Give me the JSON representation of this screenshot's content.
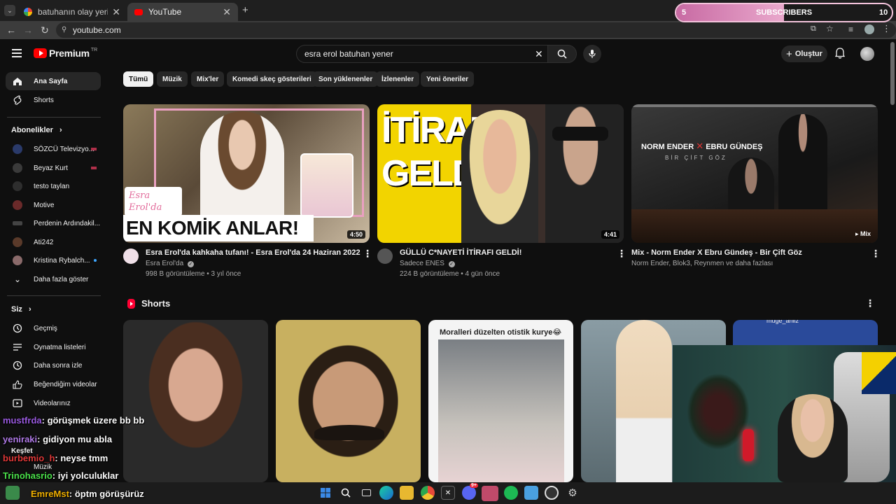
{
  "browser": {
    "tabs": [
      {
        "title": "batuhanın olay yeri - Google'da",
        "active": false
      },
      {
        "title": "YouTube",
        "active": true
      }
    ],
    "url": "youtube.com"
  },
  "youtube": {
    "logo": "Premium",
    "logo_region": "TR",
    "search_value": "esra erol batuhan yener",
    "create_label": "Oluştur",
    "sidebar": {
      "home": "Ana Sayfa",
      "shorts": "Shorts",
      "subscriptions_heading": "Abonelikler",
      "subscriptions": [
        {
          "name": "SÖZCÜ Televizyo...",
          "badge": "live-bar",
          "avatar_color": "#2a3a6a"
        },
        {
          "name": "Beyaz Kurt",
          "badge": "live-bar",
          "avatar_color": "#3a3a3a"
        },
        {
          "name": "testo taylan",
          "badge": "",
          "avatar_color": "#2e2e2e"
        },
        {
          "name": "Motive",
          "badge": "",
          "avatar_color": "#6a2a2a"
        },
        {
          "name": "Perdenin Ardındakil...",
          "badge": "",
          "avatar_color": "#444444"
        },
        {
          "name": "Ati242",
          "badge": "",
          "avatar_color": "#5a3a2a"
        },
        {
          "name": "Kristina Rybalch...",
          "badge": "dot",
          "avatar_color": "#8a6a6a"
        }
      ],
      "show_more": "Daha fazla göster",
      "you_heading": "Siz",
      "you_items": [
        {
          "label": "Geçmiş",
          "icon": "history-icon"
        },
        {
          "label": "Oynatma listeleri",
          "icon": "playlist-icon"
        },
        {
          "label": "Daha sonra izle",
          "icon": "watch-later-icon"
        },
        {
          "label": "Beğendiğim videolar",
          "icon": "like-icon"
        },
        {
          "label": "Videolarınız",
          "icon": "your-videos-icon"
        }
      ],
      "explore_heading": "Keşfet",
      "music": "Müzik"
    },
    "chips": [
      "Tümü",
      "Müzik",
      "Mix'ler",
      "Komedi skeç gösterileri",
      "Son yüklenenler",
      "İzlenenler",
      "Yeni öneriler"
    ],
    "videos": [
      {
        "title": "Esra Erol'da kahkaha tufanı! - Esra Erol'da 24 Haziran 2022",
        "channel": "Esra Erol'da",
        "verified": true,
        "meta": "998 B görüntüleme • 3 yıl önce",
        "duration": "4:50",
        "thumb_text": "EN KOMİK ANLAR!",
        "thumb_script": "Esra Erol'da"
      },
      {
        "title": "GÜLLÜ C*NAYETİ İTİRAFI GELDİ!",
        "channel": "Sadece ENES",
        "verified": true,
        "meta": "224 B görüntüleme • 4 gün önce",
        "duration": "4:41",
        "thumb_text_1": "İTİRAF",
        "thumb_text_2": "GELDİ"
      },
      {
        "title": "Mix - Norm Ender X Ebru Gündeş - Bir Çift Göz",
        "channel": "Norm Ender, Blok3, Reynmen ve daha fazlası",
        "verified": false,
        "meta": "",
        "duration": "Mix",
        "thumb_text": "NORM ENDER",
        "thumb_text_b": "EBRU GÜNDEŞ",
        "thumb_sub": "BİR ÇİFT GÖZ"
      }
    ],
    "shorts_heading": "Shorts",
    "shorts": [
      {
        "caption": "",
        "color": "#3b2e22"
      },
      {
        "caption": "",
        "color": "#4a3a22"
      },
      {
        "caption": "Moralleri düzelten otistik kurye😂",
        "color": "#d8d8d8"
      },
      {
        "caption": "",
        "color": "#6a7a80"
      },
      {
        "caption": "muge_anliz",
        "color": "#2a4a9a"
      }
    ]
  },
  "overlay": {
    "subs_start": "5",
    "subs_label": "SUBSCRIBERS",
    "subs_goal": "10",
    "subs_progress": 0.5,
    "chat": [
      {
        "user": "mustfrda",
        "msg": ": görüşmek üzere bb bb",
        "color": "#7a3ab8"
      },
      {
        "user": "yeniraki",
        "msg": ": gidiyon mu abla",
        "color": "#8a5ad0"
      },
      {
        "user": "burbemio_h",
        "msg": ": neyse tmm",
        "color": "#c82828"
      },
      {
        "user": "Trinohasrio",
        "msg": ": iyi yolculuklar",
        "color": "#3ad03a"
      },
      {
        "user": "EmreMst",
        "msg": ": öptm görüşürüz",
        "color": "#e0a000"
      }
    ]
  },
  "taskbar": {
    "apps": [
      {
        "name": "windows-start-icon",
        "color": "#3a8ae8"
      },
      {
        "name": "search-icon",
        "color": ""
      },
      {
        "name": "task-view-icon",
        "color": ""
      },
      {
        "name": "edge-icon",
        "color": "#1a8ad0"
      },
      {
        "name": "file-explorer-icon",
        "color": "#e8b830"
      },
      {
        "name": "chrome-icon",
        "color": "#e84a3a"
      },
      {
        "name": "x-icon",
        "color": "#222222"
      },
      {
        "name": "discord-icon",
        "color": "#5865f2"
      },
      {
        "name": "app-icon",
        "color": "#c04a6a"
      },
      {
        "name": "spotify-icon",
        "color": "#1db954"
      },
      {
        "name": "notepad-icon",
        "color": "#4aa0e0"
      },
      {
        "name": "obs-icon",
        "color": "#333333"
      },
      {
        "name": "settings-icon",
        "color": "#888888"
      }
    ],
    "badge": "9+"
  }
}
